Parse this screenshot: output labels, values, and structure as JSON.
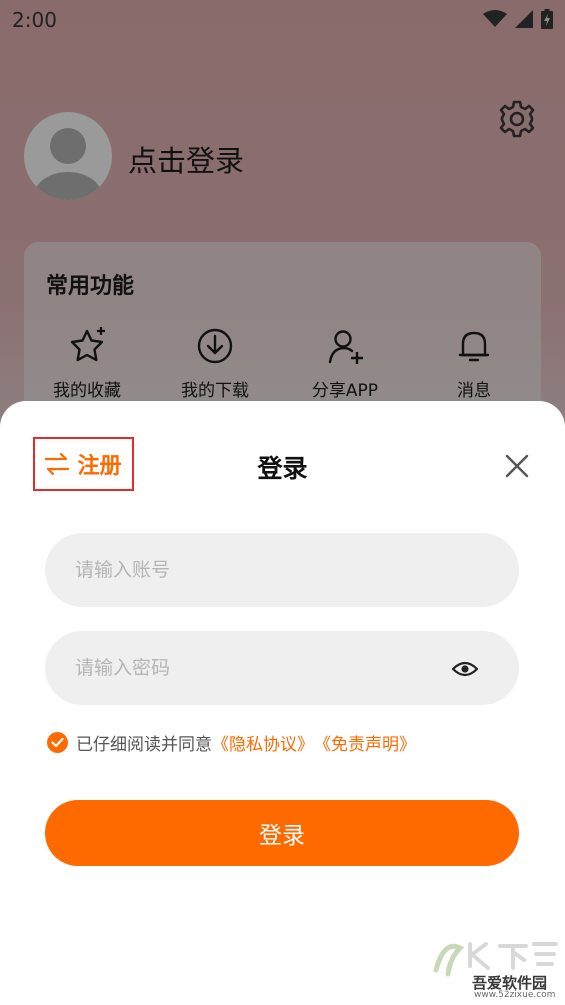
{
  "status_bar": {
    "time": "2:00"
  },
  "profile": {
    "login_prompt": "点击登录"
  },
  "functions": {
    "title": "常用功能",
    "items": [
      {
        "label": "我的收藏",
        "icon": "star-icon"
      },
      {
        "label": "我的下载",
        "icon": "download-icon"
      },
      {
        "label": "分享APP",
        "icon": "add-user-icon"
      },
      {
        "label": "消息",
        "icon": "bell-icon"
      }
    ]
  },
  "sheet": {
    "register_label": "注册",
    "title": "登录",
    "account_placeholder": "请输入账号",
    "password_placeholder": "请输入密码",
    "agree_prefix": "已仔细阅读并同意",
    "privacy_link": "《隐私协议》",
    "disclaimer_link": "《免责声明》",
    "login_button": "登录",
    "agreed": true
  },
  "watermark": {
    "name": "吾爱软件园",
    "url": "www.52zixue.com"
  },
  "colors": {
    "accent": "#ff6a00",
    "highlight_border": "#e52c2c"
  }
}
